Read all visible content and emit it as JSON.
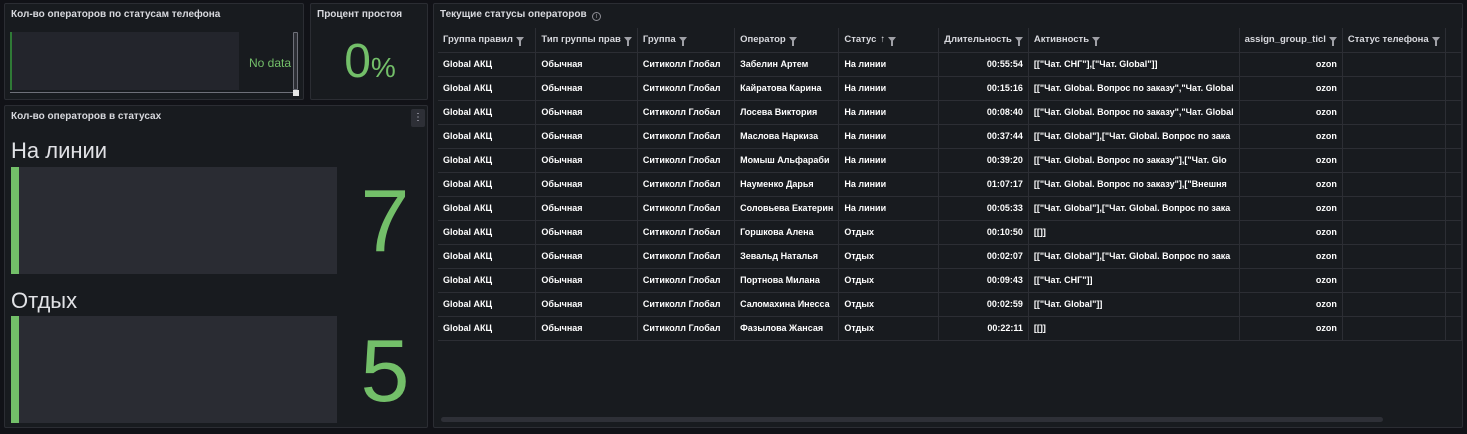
{
  "panels": {
    "phone_status_count": {
      "title": "Кол-во операторов по статусам телефона",
      "no_data": "No data"
    },
    "idle_percent": {
      "title": "Процент простоя",
      "value": "0",
      "unit": "%"
    },
    "operators_in_status": {
      "title": "Кол-во операторов в статусах",
      "menu_icon": "kebab-menu-icon",
      "stats": [
        {
          "label": "На линии",
          "value": "7"
        },
        {
          "label": "Отдых",
          "value": "5"
        }
      ]
    },
    "current_statuses": {
      "title": "Текущие статусы операторов",
      "info_icon": "info-icon",
      "columns": [
        "Группа правил",
        "Тип группы прав",
        "Группа",
        "Оператор",
        "Статус",
        "Длительность",
        "Активность",
        "assign_group_ticl",
        "Статус телефона"
      ],
      "sort_column": "Статус",
      "sort_direction": "ascending",
      "rows": [
        [
          "Global АКЦ",
          "Обычная",
          "Ситиколл Глобал",
          "Забелин Артем",
          "На линии",
          "00:55:54",
          "[[\"Чат. СНГ\"],[\"Чат. Global\"]]",
          "ozon",
          ""
        ],
        [
          "Global АКЦ",
          "Обычная",
          "Ситиколл Глобал",
          "Кайратова Карина",
          "На линии",
          "00:15:16",
          "[[\"Чат. Global. Вопрос по заказу\",\"Чат. Global",
          "ozon",
          ""
        ],
        [
          "Global АКЦ",
          "Обычная",
          "Ситиколл Глобал",
          "Лосева Виктория",
          "На линии",
          "00:08:40",
          "[[\"Чат. Global. Вопрос по заказу\",\"Чат. Global",
          "ozon",
          ""
        ],
        [
          "Global АКЦ",
          "Обычная",
          "Ситиколл Глобал",
          "Маслова Наркиза",
          "На линии",
          "00:37:44",
          "[[\"Чат. Global\"],[\"Чат. Global. Вопрос по зака",
          "ozon",
          ""
        ],
        [
          "Global АКЦ",
          "Обычная",
          "Ситиколл Глобал",
          "Момыш Альфараби",
          "На линии",
          "00:39:20",
          "[[\"Чат. Global. Вопрос по заказу\"],[\"Чат. Glo",
          "ozon",
          ""
        ],
        [
          "Global АКЦ",
          "Обычная",
          "Ситиколл Глобал",
          "Науменко Дарья",
          "На линии",
          "01:07:17",
          "[[\"Чат. Global. Вопрос по заказу\"],[\"Внешня",
          "ozon",
          ""
        ],
        [
          "Global АКЦ",
          "Обычная",
          "Ситиколл Глобал",
          "Соловьева Екатерин",
          "На линии",
          "00:05:33",
          "[[\"Чат. Global\"],[\"Чат. Global. Вопрос по зака",
          "ozon",
          ""
        ],
        [
          "Global АКЦ",
          "Обычная",
          "Ситиколл Глобал",
          "Горшкова Алена",
          "Отдых",
          "00:10:50",
          "[[]]",
          "ozon",
          ""
        ],
        [
          "Global АКЦ",
          "Обычная",
          "Ситиколл Глобал",
          "Зевальд Наталья",
          "Отдых",
          "00:02:07",
          "[[\"Чат. Global\"],[\"Чат. Global. Вопрос по зака",
          "ozon",
          ""
        ],
        [
          "Global АКЦ",
          "Обычная",
          "Ситиколл Глобал",
          "Портнова Милана",
          "Отдых",
          "00:09:43",
          "[[\"Чат. СНГ\"]]",
          "ozon",
          ""
        ],
        [
          "Global АКЦ",
          "Обычная",
          "Ситиколл Глобал",
          "Саломахина Инесса",
          "Отдых",
          "00:02:59",
          "[[\"Чат. Global\"]]",
          "ozon",
          ""
        ],
        [
          "Global АКЦ",
          "Обычная",
          "Ситиколл Глобал",
          "Фазылова Жансая",
          "Отдых",
          "00:22:11",
          "[[]]",
          "ozon",
          ""
        ]
      ]
    }
  },
  "colors": {
    "accent_green": "#73bf69",
    "background": "#111217",
    "panel": "#181b1f"
  }
}
